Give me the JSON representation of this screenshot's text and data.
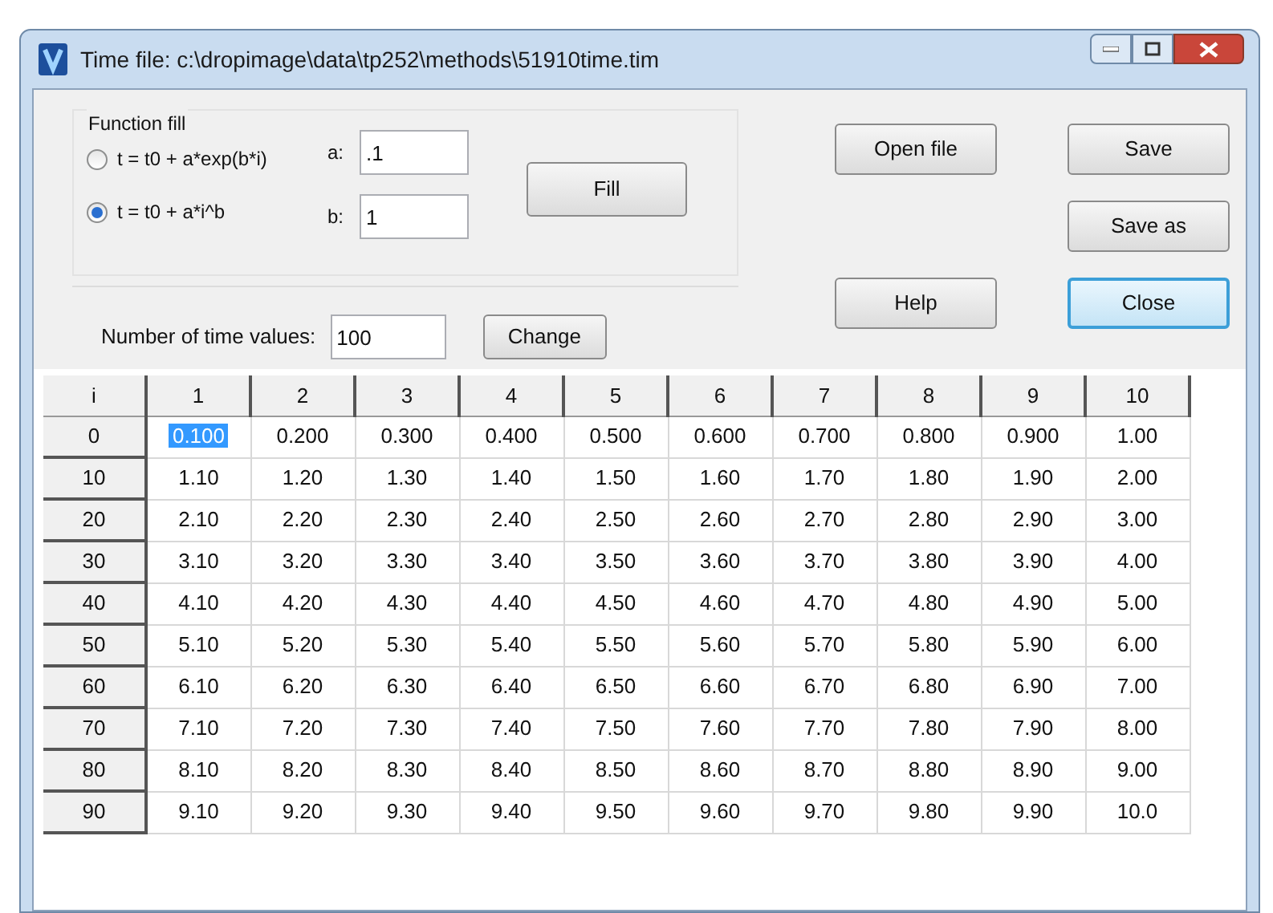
{
  "window": {
    "title": "Time file: c:\\dropimage\\data\\tp252\\methods\\51910time.tim"
  },
  "function_fill": {
    "title": "Function fill",
    "options": [
      {
        "label": "t = t0 + a*exp(b*i)",
        "selected": false
      },
      {
        "label": "t = t0 + a*i^b",
        "selected": true
      }
    ],
    "params": [
      {
        "label": "a:",
        "value": ".1"
      },
      {
        "label": "b:",
        "value": "1"
      }
    ],
    "fill_button": "Fill"
  },
  "time_values": {
    "label": "Number of time values:",
    "value": "100",
    "button": "Change"
  },
  "buttons": [
    {
      "label": "Open file",
      "focused": false
    },
    {
      "label": "Save",
      "focused": false
    },
    {
      "label": "Save as",
      "focused": false
    },
    {
      "label": "Help",
      "focused": false
    },
    {
      "label": "Close",
      "focused": true
    }
  ],
  "table": {
    "corner": "i",
    "columns": [
      "1",
      "2",
      "3",
      "4",
      "5",
      "6",
      "7",
      "8",
      "9",
      "10"
    ],
    "rows": [
      {
        "label": "0",
        "cells": [
          {
            "text": "0.100",
            "selected": true
          },
          {
            "text": "0.200",
            "selected": false
          },
          {
            "text": "0.300",
            "selected": false
          },
          {
            "text": "0.400",
            "selected": false
          },
          {
            "text": "0.500",
            "selected": false
          },
          {
            "text": "0.600",
            "selected": false
          },
          {
            "text": "0.700",
            "selected": false
          },
          {
            "text": "0.800",
            "selected": false
          },
          {
            "text": "0.900",
            "selected": false
          },
          {
            "text": "1.00",
            "selected": false
          }
        ]
      },
      {
        "label": "10",
        "cells": [
          {
            "text": "1.10",
            "selected": false
          },
          {
            "text": "1.20",
            "selected": false
          },
          {
            "text": "1.30",
            "selected": false
          },
          {
            "text": "1.40",
            "selected": false
          },
          {
            "text": "1.50",
            "selected": false
          },
          {
            "text": "1.60",
            "selected": false
          },
          {
            "text": "1.70",
            "selected": false
          },
          {
            "text": "1.80",
            "selected": false
          },
          {
            "text": "1.90",
            "selected": false
          },
          {
            "text": "2.00",
            "selected": false
          }
        ]
      },
      {
        "label": "20",
        "cells": [
          {
            "text": "2.10",
            "selected": false
          },
          {
            "text": "2.20",
            "selected": false
          },
          {
            "text": "2.30",
            "selected": false
          },
          {
            "text": "2.40",
            "selected": false
          },
          {
            "text": "2.50",
            "selected": false
          },
          {
            "text": "2.60",
            "selected": false
          },
          {
            "text": "2.70",
            "selected": false
          },
          {
            "text": "2.80",
            "selected": false
          },
          {
            "text": "2.90",
            "selected": false
          },
          {
            "text": "3.00",
            "selected": false
          }
        ]
      },
      {
        "label": "30",
        "cells": [
          {
            "text": "3.10",
            "selected": false
          },
          {
            "text": "3.20",
            "selected": false
          },
          {
            "text": "3.30",
            "selected": false
          },
          {
            "text": "3.40",
            "selected": false
          },
          {
            "text": "3.50",
            "selected": false
          },
          {
            "text": "3.60",
            "selected": false
          },
          {
            "text": "3.70",
            "selected": false
          },
          {
            "text": "3.80",
            "selected": false
          },
          {
            "text": "3.90",
            "selected": false
          },
          {
            "text": "4.00",
            "selected": false
          }
        ]
      },
      {
        "label": "40",
        "cells": [
          {
            "text": "4.10",
            "selected": false
          },
          {
            "text": "4.20",
            "selected": false
          },
          {
            "text": "4.30",
            "selected": false
          },
          {
            "text": "4.40",
            "selected": false
          },
          {
            "text": "4.50",
            "selected": false
          },
          {
            "text": "4.60",
            "selected": false
          },
          {
            "text": "4.70",
            "selected": false
          },
          {
            "text": "4.80",
            "selected": false
          },
          {
            "text": "4.90",
            "selected": false
          },
          {
            "text": "5.00",
            "selected": false
          }
        ]
      },
      {
        "label": "50",
        "cells": [
          {
            "text": "5.10",
            "selected": false
          },
          {
            "text": "5.20",
            "selected": false
          },
          {
            "text": "5.30",
            "selected": false
          },
          {
            "text": "5.40",
            "selected": false
          },
          {
            "text": "5.50",
            "selected": false
          },
          {
            "text": "5.60",
            "selected": false
          },
          {
            "text": "5.70",
            "selected": false
          },
          {
            "text": "5.80",
            "selected": false
          },
          {
            "text": "5.90",
            "selected": false
          },
          {
            "text": "6.00",
            "selected": false
          }
        ]
      },
      {
        "label": "60",
        "cells": [
          {
            "text": "6.10",
            "selected": false
          },
          {
            "text": "6.20",
            "selected": false
          },
          {
            "text": "6.30",
            "selected": false
          },
          {
            "text": "6.40",
            "selected": false
          },
          {
            "text": "6.50",
            "selected": false
          },
          {
            "text": "6.60",
            "selected": false
          },
          {
            "text": "6.70",
            "selected": false
          },
          {
            "text": "6.80",
            "selected": false
          },
          {
            "text": "6.90",
            "selected": false
          },
          {
            "text": "7.00",
            "selected": false
          }
        ]
      },
      {
        "label": "70",
        "cells": [
          {
            "text": "7.10",
            "selected": false
          },
          {
            "text": "7.20",
            "selected": false
          },
          {
            "text": "7.30",
            "selected": false
          },
          {
            "text": "7.40",
            "selected": false
          },
          {
            "text": "7.50",
            "selected": false
          },
          {
            "text": "7.60",
            "selected": false
          },
          {
            "text": "7.70",
            "selected": false
          },
          {
            "text": "7.80",
            "selected": false
          },
          {
            "text": "7.90",
            "selected": false
          },
          {
            "text": "8.00",
            "selected": false
          }
        ]
      },
      {
        "label": "80",
        "cells": [
          {
            "text": "8.10",
            "selected": false
          },
          {
            "text": "8.20",
            "selected": false
          },
          {
            "text": "8.30",
            "selected": false
          },
          {
            "text": "8.40",
            "selected": false
          },
          {
            "text": "8.50",
            "selected": false
          },
          {
            "text": "8.60",
            "selected": false
          },
          {
            "text": "8.70",
            "selected": false
          },
          {
            "text": "8.80",
            "selected": false
          },
          {
            "text": "8.90",
            "selected": false
          },
          {
            "text": "9.00",
            "selected": false
          }
        ]
      },
      {
        "label": "90",
        "cells": [
          {
            "text": "9.10",
            "selected": false
          },
          {
            "text": "9.20",
            "selected": false
          },
          {
            "text": "9.30",
            "selected": false
          },
          {
            "text": "9.40",
            "selected": false
          },
          {
            "text": "9.50",
            "selected": false
          },
          {
            "text": "9.60",
            "selected": false
          },
          {
            "text": "9.70",
            "selected": false
          },
          {
            "text": "9.80",
            "selected": false
          },
          {
            "text": "9.90",
            "selected": false
          },
          {
            "text": "10.0",
            "selected": false
          }
        ]
      }
    ]
  }
}
